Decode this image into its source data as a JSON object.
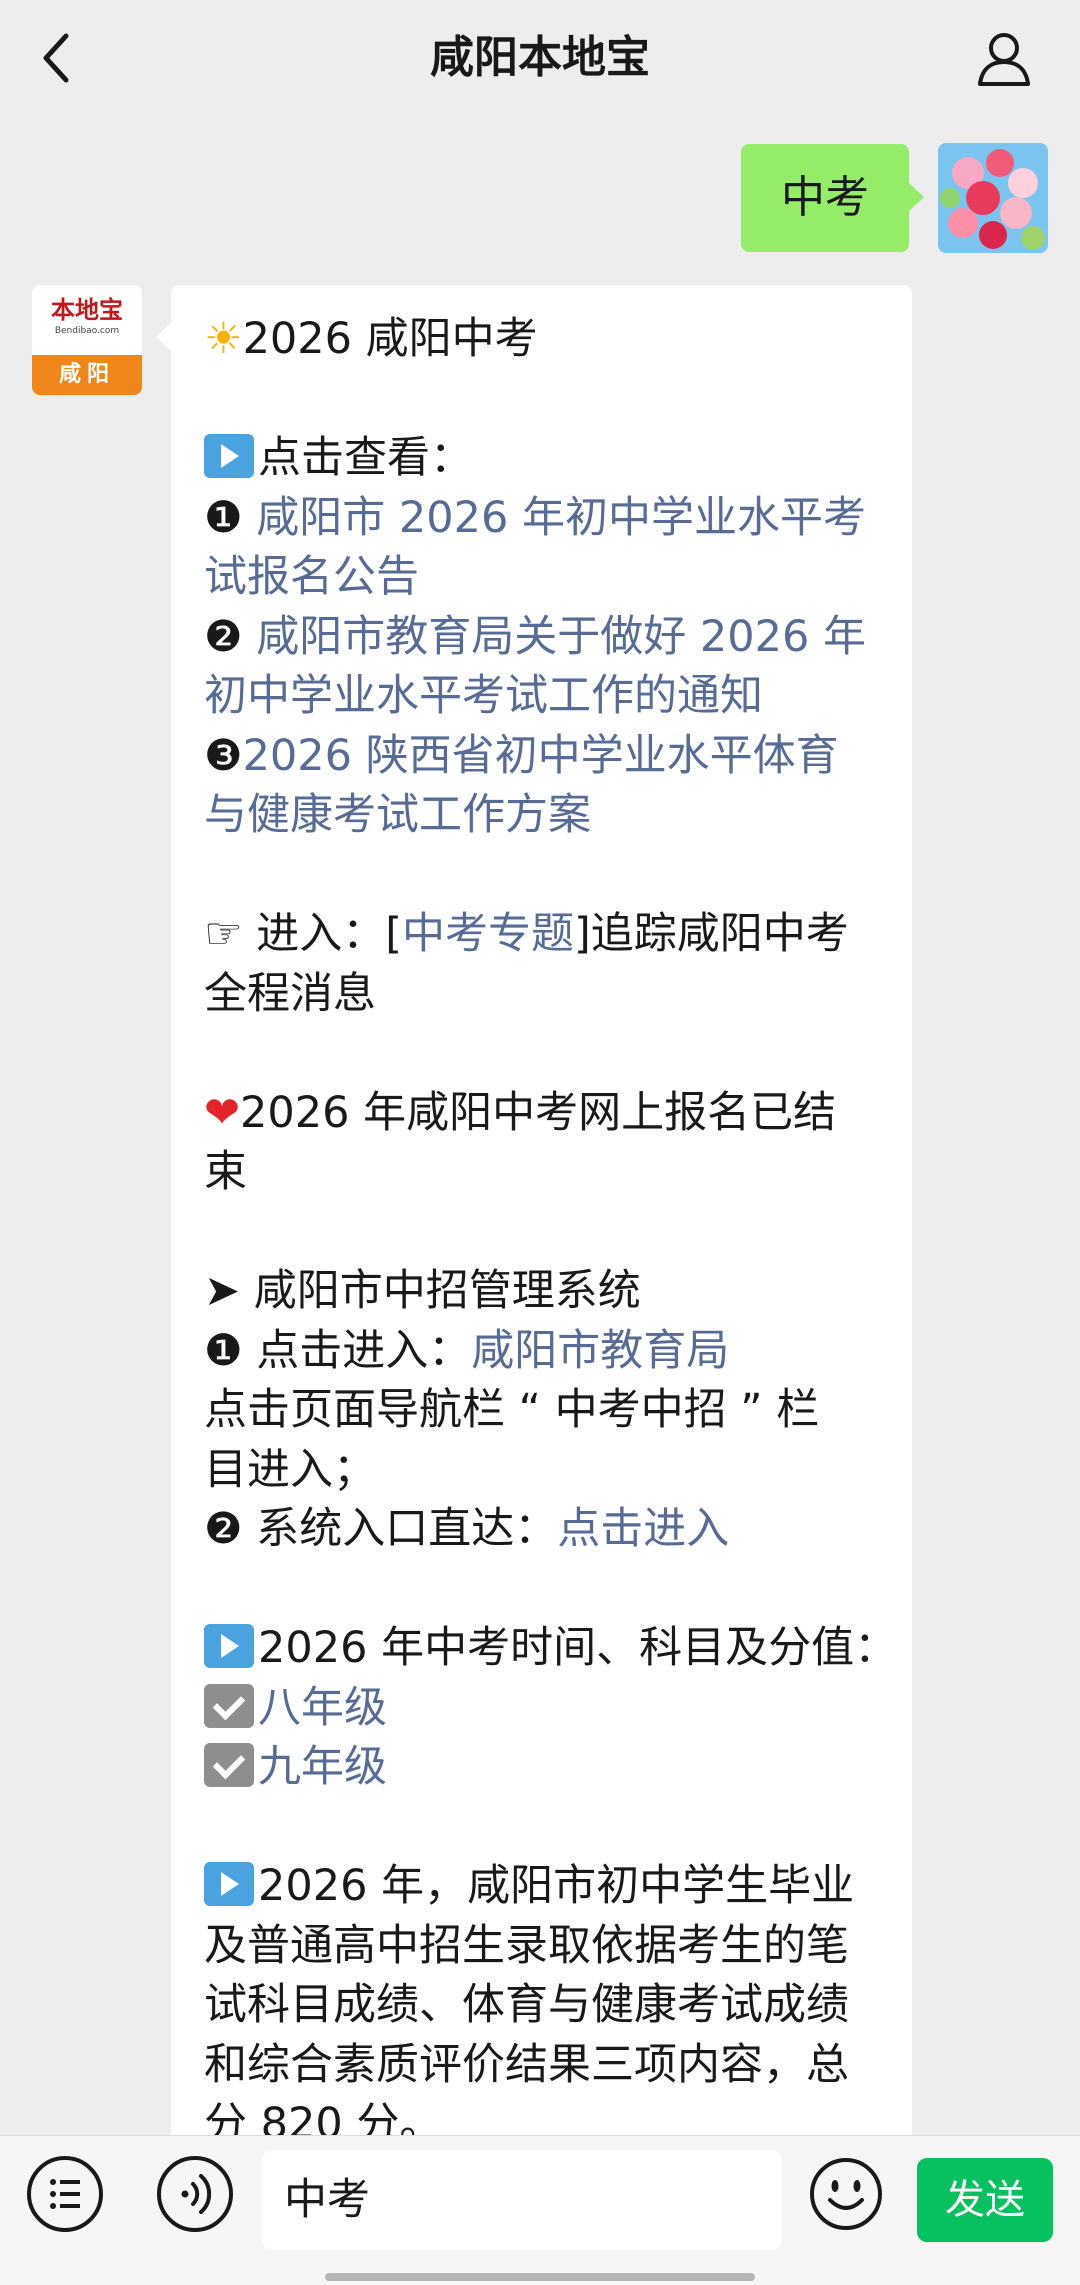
{
  "header": {
    "title": "咸阳本地宝",
    "back_icon": "chevron-left-icon",
    "profile_icon": "person-icon"
  },
  "outgoing_message": {
    "text": "中考"
  },
  "bot_avatar": {
    "logo_main": "本地宝",
    "logo_sub": "Bendibao.com",
    "logo_city": "咸阳"
  },
  "message": {
    "sun": "☀",
    "title": "2026 咸阳中考",
    "view_label": "点击查看：",
    "n1": "❶",
    "link1_line1": "咸阳市 2026 年初中学业水平考",
    "link1_line2": "试报名公告",
    "n2": "❷",
    "link2_line1": "咸阳市教育局关于做好 2026 年",
    "link2_line2": "初中学业水平考试工作的通知",
    "n3": "❸",
    "link3_line1": "2026 陕西省初中学业水平体育",
    "link3_line2": "与健康考试工作方案",
    "enter_hand": "☞",
    "enter_prefix": " 进入：",
    "bracket_open": "[",
    "enter_link": "中考专题",
    "bracket_close": "]",
    "enter_suffix": "追踪咸阳中考",
    "enter_line2": "全程消息",
    "heart": "❤",
    "reg_line1": "2026 年咸阳中考网上报名已结",
    "reg_line2": "束",
    "arrow": "➤",
    "system_title": " 咸阳市中招管理系统",
    "sys1_prefix": " 点击进入：",
    "sys1_link": "咸阳市教育局",
    "sys1_line2": "点击页面导航栏 “ 中考中招 ” 栏",
    "sys1_line3": "目进入；",
    "sys2_prefix": " 系统入口直达：",
    "sys2_link": "点击进入",
    "exam_title": "2026 年中考时间、科目及分值：",
    "grade8": "八年级",
    "grade9": "九年级",
    "p_line1": "2026 年，咸阳市初中学生毕业",
    "p_line2": "及普通高中招生录取依据考生的笔",
    "p_line3": "试科目成绩、体育与健康考试成绩",
    "p_line4": "和综合素质评价结果三项内容，总",
    "p_line5": "分 820 分。"
  },
  "input_bar": {
    "menu_icon": "list-icon",
    "voice_icon": "voice-icon",
    "input_value": "中考",
    "emoji_icon": "smiley-icon",
    "send_label": "发送"
  },
  "colors": {
    "link": "#576b95",
    "out_bubble": "#95ec69",
    "send_button": "#07c160"
  }
}
